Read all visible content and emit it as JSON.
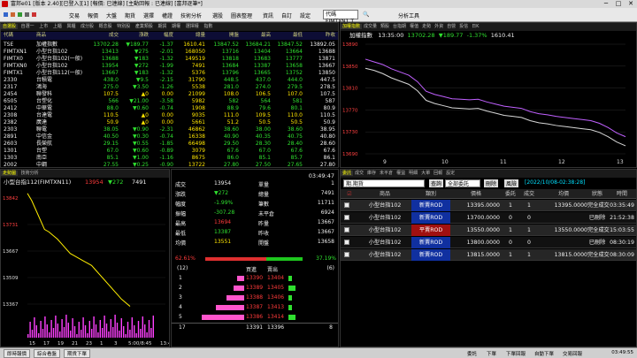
{
  "app": {
    "title": "富邦e01 [版本 2.40][已登入][1] [報價: 已連線] [主動回報 : 已連線] [富邦逐筆*]"
  },
  "menu": {
    "items": [
      "交易",
      "報價",
      "大盤",
      "期貨",
      "選擇",
      "權證",
      "技術分析",
      "選股",
      "圖表整理",
      "資訊",
      "自訂",
      "設定"
    ],
    "command_value": "代碼 FIMTXN1.T",
    "help_label": "分析工具"
  },
  "quote_table": {
    "tabs": [
      "自選股",
      "自選一",
      "上市",
      "上櫃",
      "興櫃",
      "成分股",
      "概念股",
      "特別股",
      "產業類股",
      "期貨",
      "期權",
      "選擇權",
      "指數",
      "期貨",
      "指數",
      "報價"
    ],
    "headers": [
      "代碼",
      "商品",
      "成交",
      "漲跌",
      "幅度",
      "總量",
      "開盤",
      "最高",
      "最低",
      "昨收"
    ],
    "rows": [
      [
        "TSE",
        "加權指數",
        "13702.28",
        "▼189.77",
        "-1.37",
        "1610.41",
        "13847.52",
        "13684.21",
        "13847.52",
        "13892.05"
      ],
      [
        "FIMTXN1",
        "小型台指102",
        "13413",
        "▼275",
        "-2.01",
        "168050",
        "13716",
        "13404",
        "13664",
        "13688"
      ],
      [
        "FIMTX0",
        "小型台指102(一般)",
        "13688",
        "▼183",
        "-1.32",
        "149519",
        "13818",
        "13683",
        "13777",
        "13871"
      ],
      [
        "FIMTXN0",
        "小型台指102",
        "13954",
        "▼272",
        "-1.99",
        "7491",
        "13684",
        "13387",
        "13658",
        "13667"
      ],
      [
        "FIMTX1",
        "小型台指112(一般)",
        "13667",
        "▼183",
        "-1.32",
        "5376",
        "13796",
        "13665",
        "13752",
        "13850"
      ],
      [
        "2330",
        "台積電",
        "438.0",
        "▼9.5",
        "-2.15",
        "31790",
        "448.5",
        "437.0",
        "444.0",
        "447.5"
      ],
      [
        "2317",
        "鴻海",
        "275.0",
        "▼3.50",
        "-1.26",
        "5538",
        "281.0",
        "274.0",
        "279.5",
        "278.5"
      ],
      [
        "2454",
        "聯發科",
        "107.5",
        "▲0",
        "0.00",
        "21099",
        "108.0",
        "106.5",
        "107.0",
        "107.5"
      ],
      [
        "6505",
        "台塑化",
        "566",
        "▼21.00",
        "-3.58",
        "5982",
        "582",
        "564",
        "581",
        "587"
      ],
      [
        "2412",
        "中華電",
        "88.0",
        "▼0.60",
        "-0.74",
        "1908",
        "88.9",
        "79.6",
        "80.1",
        "80.9"
      ],
      [
        "2308",
        "台達電",
        "110.5",
        "▲0",
        "0.00",
        "9035",
        "111.0",
        "109.5",
        "110.0",
        "110.5"
      ],
      [
        "2382",
        "廣達",
        "50.9",
        "▲0",
        "0.00",
        "5661",
        "51.2",
        "50.5",
        "50.5",
        "50.9"
      ],
      [
        "2303",
        "聯電",
        "38.05",
        "▼0.90",
        "-2.31",
        "46862",
        "38.60",
        "38.00",
        "38.60",
        "38.95"
      ],
      [
        "2891",
        "中信金",
        "40.50",
        "▼0.30",
        "-0.74",
        "16338",
        "40.90",
        "40.35",
        "40.75",
        "40.80"
      ],
      [
        "2603",
        "長榮航",
        "29.15",
        "▼0.55",
        "-1.85",
        "66498",
        "29.50",
        "28.30",
        "28.40",
        "28.60"
      ],
      [
        "1301",
        "台塑",
        "67.0",
        "▼0.60",
        "-0.89",
        "3079",
        "67.6",
        "67.0",
        "67.6",
        "67.6"
      ],
      [
        "1303",
        "南亞",
        "85.1",
        "▼1.00",
        "-1.16",
        "8675",
        "86.0",
        "85.1",
        "85.7",
        "86.1"
      ],
      [
        "2002",
        "中鋼",
        "27.55",
        "▼0.25",
        "-0.90",
        "13722",
        "27.80",
        "27.50",
        "27.65",
        "27.80"
      ]
    ]
  },
  "index_chart": {
    "tabs": [
      "加權指數",
      "成交量",
      "類股",
      "台指期",
      "權值",
      "走勢",
      "外資",
      "自營",
      "投信",
      "日K"
    ],
    "name": "加權指數",
    "time": "13:35:00",
    "price": "13702.28",
    "change": "▼189.77",
    "pct": "-1.37%",
    "volume": "1610.41",
    "y_labels": [
      "13890",
      "13850",
      "13810",
      "13770",
      "13730",
      "13690"
    ],
    "x_labels": [
      "9",
      "10",
      "11",
      "12",
      "13"
    ],
    "chart_data": {
      "type": "line",
      "title": "加權指數",
      "x": [
        0,
        1,
        2,
        3,
        4,
        5,
        6,
        7,
        8,
        9,
        10,
        11,
        12,
        13,
        14,
        15,
        16,
        17,
        18,
        19,
        20,
        21,
        22,
        23,
        24,
        25,
        26,
        27,
        28,
        29,
        30
      ],
      "series": [
        {
          "values": [
            13850,
            13846,
            13840,
            13832,
            13826,
            13820,
            13808,
            13790,
            13784,
            13780,
            13776,
            13775,
            13774,
            13775,
            13770,
            13766,
            13762,
            13760,
            13758,
            13752,
            13748,
            13746,
            13743,
            13741,
            13739,
            13737,
            13735,
            13730,
            13722,
            13712,
            13705
          ]
        },
        {
          "values": [
            13867,
            13862,
            13857,
            13849,
            13843,
            13837,
            13825,
            13807,
            13801,
            13797,
            13793,
            13792,
            13791,
            13792,
            13787,
            13783,
            13779,
            13777,
            13775,
            13769,
            13765,
            13763,
            13760,
            13758,
            13756,
            13754,
            13752,
            13747,
            13739,
            13729,
            13722
          ]
        }
      ],
      "ylim": [
        13690,
        13895
      ]
    }
  },
  "futures_chart": {
    "tabs": [
      "走勢圖",
      "技術分析"
    ],
    "name": "小型台指112(FIMTXN11)",
    "price": "13954",
    "change": "▼272",
    "volume": "7491",
    "clock": "03:49:47",
    "y_labels": [
      "13842",
      "13731",
      "13667",
      "13509",
      "13367"
    ],
    "x_labels": [
      "15",
      "17",
      "19",
      "21",
      "23",
      "1",
      "3",
      "5:00/8:45",
      "13:45"
    ],
    "chart_data": {
      "type": "line",
      "x": [
        0,
        1,
        2,
        3,
        4,
        5,
        6,
        7,
        8,
        9,
        10,
        11,
        12,
        13,
        14,
        15,
        16,
        17,
        18,
        19,
        20,
        21,
        22,
        23,
        24
      ],
      "values": [
        13850,
        13820,
        13780,
        13740,
        13700,
        13690,
        13675,
        13660,
        13640,
        13620,
        13600,
        13590,
        13580,
        13570,
        13560,
        13550,
        13530,
        13510,
        13490,
        13470,
        13450,
        13430,
        13410,
        13395,
        13380
      ],
      "ylim": [
        13360,
        13860
      ]
    }
  },
  "quote_detail": {
    "left_labels": [
      "成交",
      "漲跌",
      "幅度",
      "振幅",
      "最高",
      "最低",
      "均價"
    ],
    "left_values": [
      "13954",
      "▼272",
      "-1.99%",
      "-307.28",
      "13694",
      "13387",
      "13551"
    ],
    "right_labels": [
      "單量",
      "總量",
      "筆數",
      "未平倉",
      "昨量",
      "昨收",
      "開盤"
    ],
    "right_values": [
      "1",
      "7491",
      "11711",
      "6924",
      "13667",
      "13667",
      "13658"
    ],
    "buy_pct": "62.61%",
    "sell_pct": "37.19%",
    "depth_header": [
      "(12)",
      "買進",
      "賣出",
      "(6)"
    ],
    "depth": [
      {
        "lvl": "1",
        "bid": "13390",
        "ask": "13404",
        "bidq": "",
        "askq": ""
      },
      {
        "lvl": "2",
        "bid": "13389",
        "ask": "13405",
        "bidq": "",
        "askq": ""
      },
      {
        "lvl": "3",
        "bid": "13388",
        "ask": "13406",
        "bidq": "",
        "askq": ""
      },
      {
        "lvl": "4",
        "bid": "13387",
        "ask": "13413",
        "bidq": "",
        "askq": ""
      },
      {
        "lvl": "5",
        "bid": "13386",
        "ask": "13414",
        "bidq": "",
        "askq": ""
      }
    ],
    "depth_sizes": {
      "bid": [
        2,
        3,
        5,
        8,
        12
      ],
      "ask": [
        1,
        2,
        1,
        1,
        2
      ]
    },
    "total": {
      "bidq": "17",
      "bid": "13391",
      "ask": "13396",
      "askq": "8"
    }
  },
  "orders": {
    "tabs": [
      "委託",
      "成交",
      "庫存",
      "未平倉",
      "權益",
      "明細",
      "大單",
      "回報",
      "設定"
    ],
    "account_label": "期.期貨",
    "query_label": "查詢",
    "filter_label": "全部委託",
    "delete_label": "刪除",
    "risk_label": "風險",
    "timestamp": "[2022/10/08-02:38:28]",
    "headers": [
      "商品",
      "類別",
      "價格",
      "委託",
      "成交",
      "均價",
      "狀態",
      "時間"
    ],
    "rows": [
      [
        "小型台指102",
        "新賣ROD",
        "13395.0000",
        "1",
        "1",
        "13395.0000",
        "完全成交",
        "03:35:49"
      ],
      [
        "小型台指102",
        "新賣ROD",
        "13700.0000",
        "0",
        "0",
        "",
        "已刪除",
        "21:52:38"
      ],
      [
        "小型台指102",
        "平賣ROD",
        "13550.0000",
        "1",
        "1",
        "13550.0000",
        "完全成交",
        "15:03:55"
      ],
      [
        "小型台指102",
        "新賣ROD",
        "13800.0000",
        "0",
        "0",
        "",
        "已刪除",
        "08:30:19"
      ],
      [
        "小型台指102",
        "新賣ROD",
        "13815.0000",
        "1",
        "1",
        "13815.0000",
        "完全成交",
        "08:30:09"
      ]
    ]
  },
  "statusbar": {
    "items": [
      "即時報價",
      "綜合看盤",
      "期貨下單"
    ],
    "right_items": [
      "委託",
      "下單",
      "下單回報",
      "自動下單",
      "交易回報"
    ],
    "time": "03:49:55"
  }
}
